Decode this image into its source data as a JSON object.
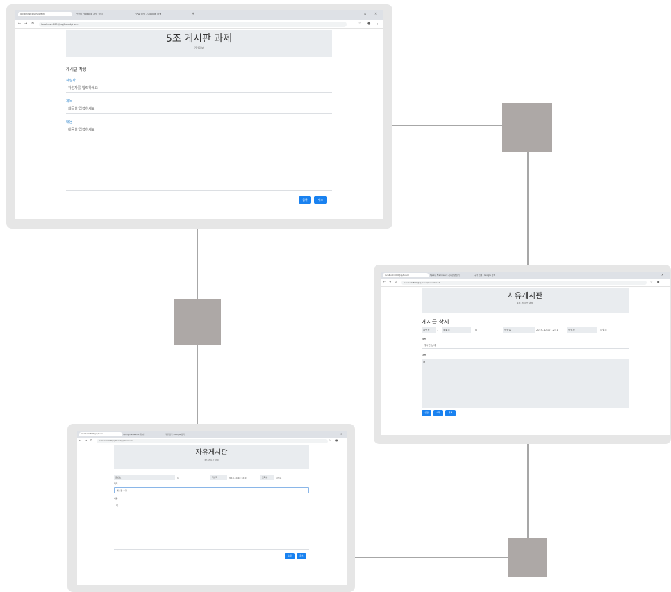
{
  "screen1": {
    "tabs": [
      "localhost:8090/DMS/",
      "[번역] Hadoop 개념 정리",
      "구글 검색 - Google 검색"
    ],
    "url": "localhost:8090/jsp/board/insert",
    "title": "5조 게시판 과제",
    "subtitle": "(주)정보",
    "section": "게시글 작성",
    "labels": [
      "작성자",
      "제목",
      "내용"
    ],
    "placeholders": [
      "작성자를 입력하세요",
      "제목을 입력하세요",
      "내용을 입력하세요"
    ],
    "buttons": [
      "등록",
      "취소"
    ]
  },
  "screen2": {
    "tabs": [
      "localhost:8090/jsp/board",
      "Spring Framework 게시판 만들기",
      "구글 검색 - Google 검색"
    ],
    "url": "localhost:8090/jsp/board/detail?no=1",
    "title": "사유게시판",
    "subtitle": "4조 게시판 과제",
    "section": "게시글 상세",
    "info_cells": [
      "글번호",
      "1",
      "조회수",
      "0",
      "작성일",
      "2019-10-10 12:51",
      "작성자",
      "김철수"
    ],
    "labels": [
      "제목",
      "내용"
    ],
    "values": [
      "게시판 상세",
      "내"
    ],
    "buttons": [
      "수정",
      "삭제",
      "목록"
    ]
  },
  "screen3": {
    "tabs": [
      "localhost:8090/jsp/board",
      "Spring Framework 게시판",
      "구글 검색 - Google 검색"
    ],
    "url": "localhost:8090/jsp/board/update?no=1",
    "title": "자유게시판",
    "subtitle": "3조 게시판 과제",
    "info_cells": [
      "글번호",
      "1",
      "작성자",
      "2019-10-10 12:51",
      "조회수",
      "김철수"
    ],
    "labels": [
      "제목",
      "내용"
    ],
    "values": [
      "게시판 수정",
      "내"
    ],
    "buttons": [
      "수정",
      "취소"
    ]
  }
}
